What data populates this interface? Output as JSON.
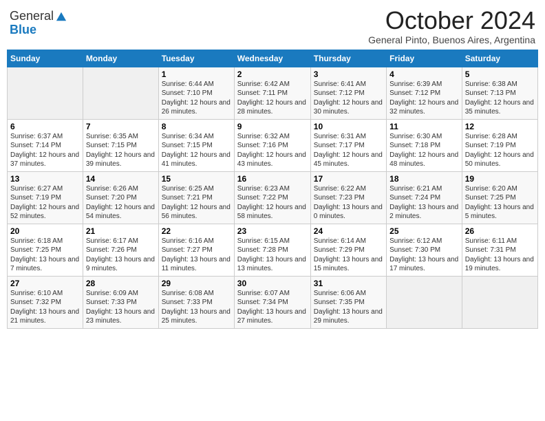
{
  "header": {
    "logo_general": "General",
    "logo_blue": "Blue",
    "month_title": "October 2024",
    "location": "General Pinto, Buenos Aires, Argentina"
  },
  "days_of_week": [
    "Sunday",
    "Monday",
    "Tuesday",
    "Wednesday",
    "Thursday",
    "Friday",
    "Saturday"
  ],
  "weeks": [
    [
      {
        "day": "",
        "info": ""
      },
      {
        "day": "",
        "info": ""
      },
      {
        "day": "1",
        "info": "Sunrise: 6:44 AM\nSunset: 7:10 PM\nDaylight: 12 hours and 26 minutes."
      },
      {
        "day": "2",
        "info": "Sunrise: 6:42 AM\nSunset: 7:11 PM\nDaylight: 12 hours and 28 minutes."
      },
      {
        "day": "3",
        "info": "Sunrise: 6:41 AM\nSunset: 7:12 PM\nDaylight: 12 hours and 30 minutes."
      },
      {
        "day": "4",
        "info": "Sunrise: 6:39 AM\nSunset: 7:12 PM\nDaylight: 12 hours and 32 minutes."
      },
      {
        "day": "5",
        "info": "Sunrise: 6:38 AM\nSunset: 7:13 PM\nDaylight: 12 hours and 35 minutes."
      }
    ],
    [
      {
        "day": "6",
        "info": "Sunrise: 6:37 AM\nSunset: 7:14 PM\nDaylight: 12 hours and 37 minutes."
      },
      {
        "day": "7",
        "info": "Sunrise: 6:35 AM\nSunset: 7:15 PM\nDaylight: 12 hours and 39 minutes."
      },
      {
        "day": "8",
        "info": "Sunrise: 6:34 AM\nSunset: 7:15 PM\nDaylight: 12 hours and 41 minutes."
      },
      {
        "day": "9",
        "info": "Sunrise: 6:32 AM\nSunset: 7:16 PM\nDaylight: 12 hours and 43 minutes."
      },
      {
        "day": "10",
        "info": "Sunrise: 6:31 AM\nSunset: 7:17 PM\nDaylight: 12 hours and 45 minutes."
      },
      {
        "day": "11",
        "info": "Sunrise: 6:30 AM\nSunset: 7:18 PM\nDaylight: 12 hours and 48 minutes."
      },
      {
        "day": "12",
        "info": "Sunrise: 6:28 AM\nSunset: 7:19 PM\nDaylight: 12 hours and 50 minutes."
      }
    ],
    [
      {
        "day": "13",
        "info": "Sunrise: 6:27 AM\nSunset: 7:19 PM\nDaylight: 12 hours and 52 minutes."
      },
      {
        "day": "14",
        "info": "Sunrise: 6:26 AM\nSunset: 7:20 PM\nDaylight: 12 hours and 54 minutes."
      },
      {
        "day": "15",
        "info": "Sunrise: 6:25 AM\nSunset: 7:21 PM\nDaylight: 12 hours and 56 minutes."
      },
      {
        "day": "16",
        "info": "Sunrise: 6:23 AM\nSunset: 7:22 PM\nDaylight: 12 hours and 58 minutes."
      },
      {
        "day": "17",
        "info": "Sunrise: 6:22 AM\nSunset: 7:23 PM\nDaylight: 13 hours and 0 minutes."
      },
      {
        "day": "18",
        "info": "Sunrise: 6:21 AM\nSunset: 7:24 PM\nDaylight: 13 hours and 2 minutes."
      },
      {
        "day": "19",
        "info": "Sunrise: 6:20 AM\nSunset: 7:25 PM\nDaylight: 13 hours and 5 minutes."
      }
    ],
    [
      {
        "day": "20",
        "info": "Sunrise: 6:18 AM\nSunset: 7:25 PM\nDaylight: 13 hours and 7 minutes."
      },
      {
        "day": "21",
        "info": "Sunrise: 6:17 AM\nSunset: 7:26 PM\nDaylight: 13 hours and 9 minutes."
      },
      {
        "day": "22",
        "info": "Sunrise: 6:16 AM\nSunset: 7:27 PM\nDaylight: 13 hours and 11 minutes."
      },
      {
        "day": "23",
        "info": "Sunrise: 6:15 AM\nSunset: 7:28 PM\nDaylight: 13 hours and 13 minutes."
      },
      {
        "day": "24",
        "info": "Sunrise: 6:14 AM\nSunset: 7:29 PM\nDaylight: 13 hours and 15 minutes."
      },
      {
        "day": "25",
        "info": "Sunrise: 6:12 AM\nSunset: 7:30 PM\nDaylight: 13 hours and 17 minutes."
      },
      {
        "day": "26",
        "info": "Sunrise: 6:11 AM\nSunset: 7:31 PM\nDaylight: 13 hours and 19 minutes."
      }
    ],
    [
      {
        "day": "27",
        "info": "Sunrise: 6:10 AM\nSunset: 7:32 PM\nDaylight: 13 hours and 21 minutes."
      },
      {
        "day": "28",
        "info": "Sunrise: 6:09 AM\nSunset: 7:33 PM\nDaylight: 13 hours and 23 minutes."
      },
      {
        "day": "29",
        "info": "Sunrise: 6:08 AM\nSunset: 7:33 PM\nDaylight: 13 hours and 25 minutes."
      },
      {
        "day": "30",
        "info": "Sunrise: 6:07 AM\nSunset: 7:34 PM\nDaylight: 13 hours and 27 minutes."
      },
      {
        "day": "31",
        "info": "Sunrise: 6:06 AM\nSunset: 7:35 PM\nDaylight: 13 hours and 29 minutes."
      },
      {
        "day": "",
        "info": ""
      },
      {
        "day": "",
        "info": ""
      }
    ]
  ]
}
